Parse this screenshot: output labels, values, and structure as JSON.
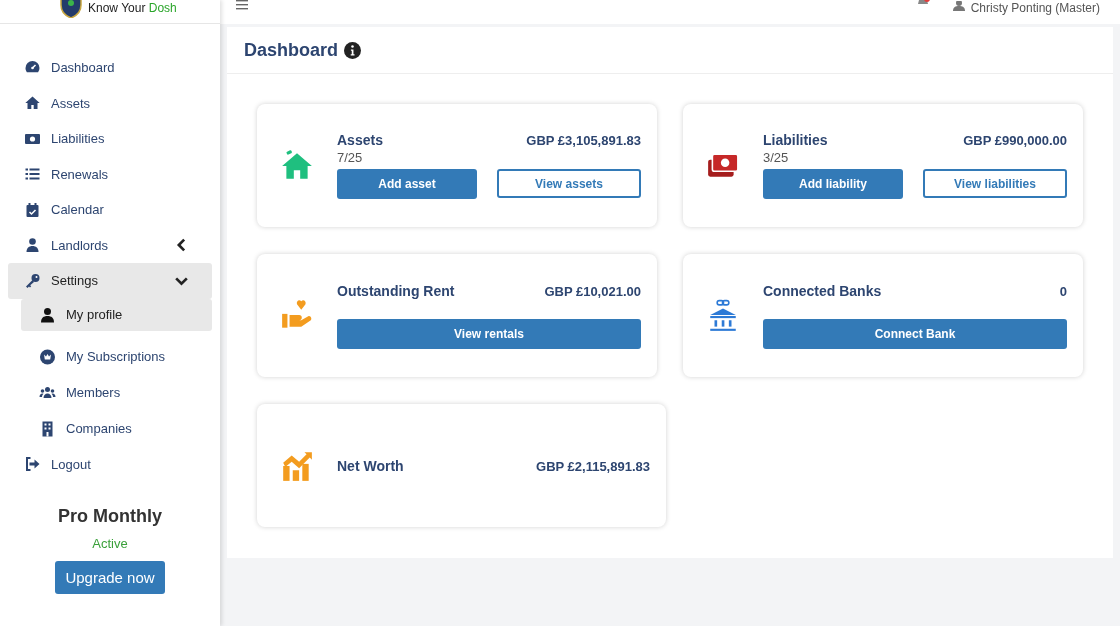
{
  "brand": {
    "name": "Know Your",
    "accent": "Dosh"
  },
  "topbar": {
    "user": "Christy Ponting (Master)"
  },
  "sidebar": {
    "items": [
      {
        "label": "Dashboard",
        "selected": false
      },
      {
        "label": "Assets",
        "selected": false
      },
      {
        "label": "Liabilities",
        "selected": false
      },
      {
        "label": "Renewals",
        "selected": false
      },
      {
        "label": "Calendar",
        "selected": false
      },
      {
        "label": "Landlords",
        "selected": false,
        "expanded": false
      },
      {
        "label": "Settings",
        "selected": true,
        "expanded": true,
        "children": [
          {
            "label": "My profile",
            "selected": true
          },
          {
            "label": "My Subscriptions",
            "selected": false
          },
          {
            "label": "Members",
            "selected": false
          },
          {
            "label": "Companies",
            "selected": false
          }
        ]
      },
      {
        "label": "Logout",
        "selected": false
      }
    ]
  },
  "plan": {
    "name": "Pro Monthly",
    "status": "Active",
    "button": "Upgrade now"
  },
  "page": {
    "title": "Dashboard"
  },
  "cards": [
    {
      "title": "Assets",
      "amount": "GBP £3,105,891.83",
      "count": "7/25",
      "buttons": [
        {
          "label": "Add asset",
          "kind": "primary"
        },
        {
          "label": "View assets",
          "kind": "outline"
        }
      ]
    },
    {
      "title": "Liabilities",
      "amount": "GBP £990,000.00",
      "count": "3/25",
      "buttons": [
        {
          "label": "Add liability",
          "kind": "primary"
        },
        {
          "label": "View liabilities",
          "kind": "outline"
        }
      ]
    },
    {
      "title": "Outstanding Rent",
      "amount": "GBP £10,021.00",
      "buttons": [
        {
          "label": "View rentals",
          "kind": "primary"
        }
      ]
    },
    {
      "title": "Connected Banks",
      "amount": "0",
      "buttons": [
        {
          "label": "Connect Bank",
          "kind": "primary"
        }
      ]
    },
    {
      "title": "Net Worth",
      "amount": "GBP £2,115,891.83"
    }
  ]
}
